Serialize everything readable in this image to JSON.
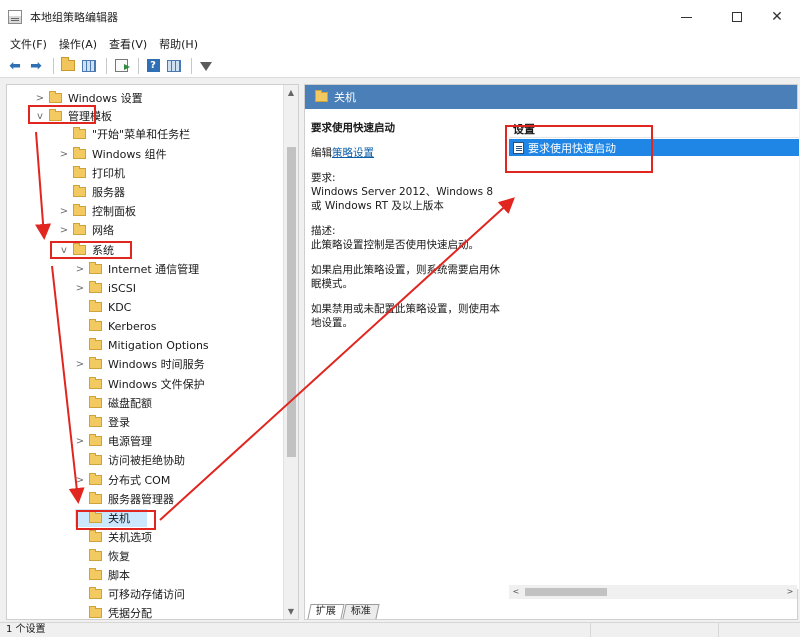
{
  "window": {
    "title": "本地组策略编辑器",
    "controls": {
      "minimize": "–",
      "maximize": "□",
      "close": "✕"
    }
  },
  "menu": [
    "文件(F)",
    "操作(A)",
    "查看(V)",
    "帮助(H)"
  ],
  "toolbar": {
    "icons": [
      "back-arrow",
      "forward-arrow",
      "folder-up",
      "show-hide-tree",
      "export-list",
      "help",
      "properties",
      "filter"
    ]
  },
  "tree": {
    "items": [
      {
        "label": "Windows 设置",
        "chevron": ">"
      },
      {
        "label": "管理模板",
        "chevron": "v"
      },
      {
        "label": "\"开始\"菜单和任务栏",
        "chevron": ""
      },
      {
        "label": "Windows 组件",
        "chevron": ">"
      },
      {
        "label": "打印机",
        "chevron": ""
      },
      {
        "label": "服务器",
        "chevron": ""
      },
      {
        "label": "控制面板",
        "chevron": ">"
      },
      {
        "label": "网络",
        "chevron": ">"
      },
      {
        "label": "系统",
        "chevron": "v"
      },
      {
        "label": "Internet 通信管理",
        "chevron": ">"
      },
      {
        "label": "iSCSI",
        "chevron": ">"
      },
      {
        "label": "KDC",
        "chevron": ""
      },
      {
        "label": "Kerberos",
        "chevron": ""
      },
      {
        "label": "Mitigation Options",
        "chevron": ""
      },
      {
        "label": "Windows 时间服务",
        "chevron": ">"
      },
      {
        "label": "Windows 文件保护",
        "chevron": ""
      },
      {
        "label": "磁盘配额",
        "chevron": ""
      },
      {
        "label": "登录",
        "chevron": ""
      },
      {
        "label": "电源管理",
        "chevron": ">"
      },
      {
        "label": "访问被拒绝协助",
        "chevron": ""
      },
      {
        "label": "分布式 COM",
        "chevron": ">"
      },
      {
        "label": "服务器管理器",
        "chevron": ""
      },
      {
        "label": "关机",
        "chevron": ""
      },
      {
        "label": "关机选项",
        "chevron": ""
      },
      {
        "label": "恢复",
        "chevron": ""
      },
      {
        "label": "脚本",
        "chevron": ""
      },
      {
        "label": "可移动存储访问",
        "chevron": ""
      },
      {
        "label": "凭据分配",
        "chevron": ""
      }
    ],
    "scroll_up": "▲",
    "scroll_down": "▼"
  },
  "right": {
    "header": "关机",
    "policy_title": "要求使用快速启动",
    "edit_prefix": "编辑",
    "edit_link": "策略设置",
    "requirement_label": "要求:",
    "requirement_text": "Windows Server 2012、Windows 8 或 Windows RT 及以上版本",
    "description_label": "描述:",
    "description_text": "此策略设置控制是否使用快速启动。",
    "enabled_text": "如果启用此策略设置，则系统需要启用休眠模式。",
    "disabled_text": "如果禁用或未配置此策略设置，则使用本地设置。",
    "list_header": "设置",
    "list_item": "要求使用快速启动",
    "hscroll_left": "<",
    "hscroll_right": ">",
    "tabs": [
      "扩展",
      "标准"
    ]
  },
  "status": {
    "text": "1 个设置"
  }
}
